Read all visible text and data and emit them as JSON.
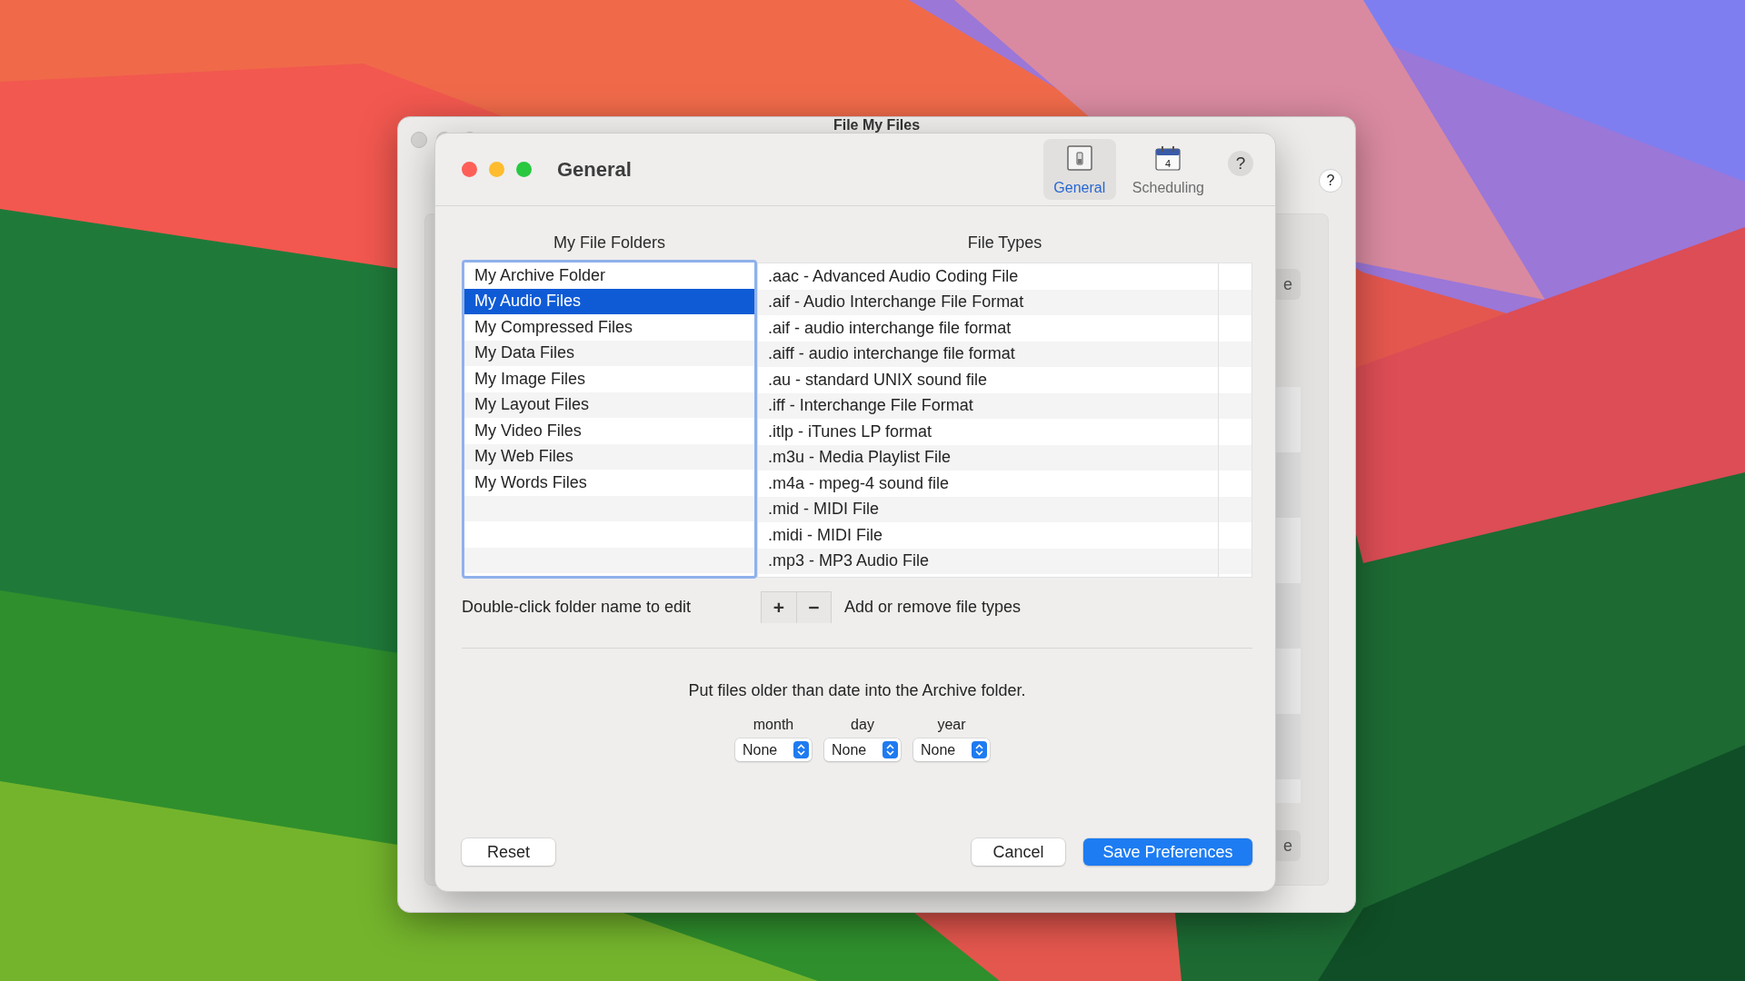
{
  "back_window": {
    "title": "File My Files",
    "help": "?",
    "top_button": "e",
    "bottom_button": "e"
  },
  "sheet": {
    "title": "General",
    "toolbar": [
      {
        "label": "General",
        "kind": "switch",
        "selected": true
      },
      {
        "label": "Scheduling",
        "kind": "calendar",
        "badge": "4",
        "selected": false
      }
    ],
    "help": "?",
    "folders": {
      "header": "My File Folders",
      "items": [
        {
          "label": "My Archive Folder",
          "selected": false
        },
        {
          "label": "My Audio Files",
          "selected": true
        },
        {
          "label": "My Compressed Files",
          "selected": false
        },
        {
          "label": "My Data Files",
          "selected": false
        },
        {
          "label": "My Image Files",
          "selected": false
        },
        {
          "label": "My Layout Files",
          "selected": false
        },
        {
          "label": "My Video Files",
          "selected": false
        },
        {
          "label": "My Web Files",
          "selected": false
        },
        {
          "label": "My Words Files",
          "selected": false
        }
      ]
    },
    "file_types": {
      "header": "File Types",
      "items": [
        ".aac - Advanced Audio Coding File",
        ".aif - Audio Interchange File Format",
        ".aif - audio interchange file format",
        ".aiff - audio interchange file format",
        ".au - standard UNIX sound file",
        ".iff - Interchange File Format",
        ".itlp - iTunes LP format",
        ".m3u - Media Playlist File",
        ".m4a - mpeg-4 sound file",
        ".mid - MIDI File",
        ".midi - MIDI File",
        ".mp3 - MP3 Audio File"
      ]
    },
    "folder_hint": "Double-click folder name to edit",
    "add_button": "+",
    "remove_button": "−",
    "types_hint": "Add or remove file types",
    "archive_instruction": "Put files older than date into the Archive folder.",
    "date_fields": [
      {
        "label": "month",
        "value": "None"
      },
      {
        "label": "day",
        "value": "None"
      },
      {
        "label": "year",
        "value": "None"
      }
    ],
    "buttons": [
      {
        "label": "Reset",
        "kind": "plain"
      },
      {
        "label": "Cancel",
        "kind": "plain"
      },
      {
        "label": "Save Preferences",
        "kind": "primary"
      }
    ]
  }
}
